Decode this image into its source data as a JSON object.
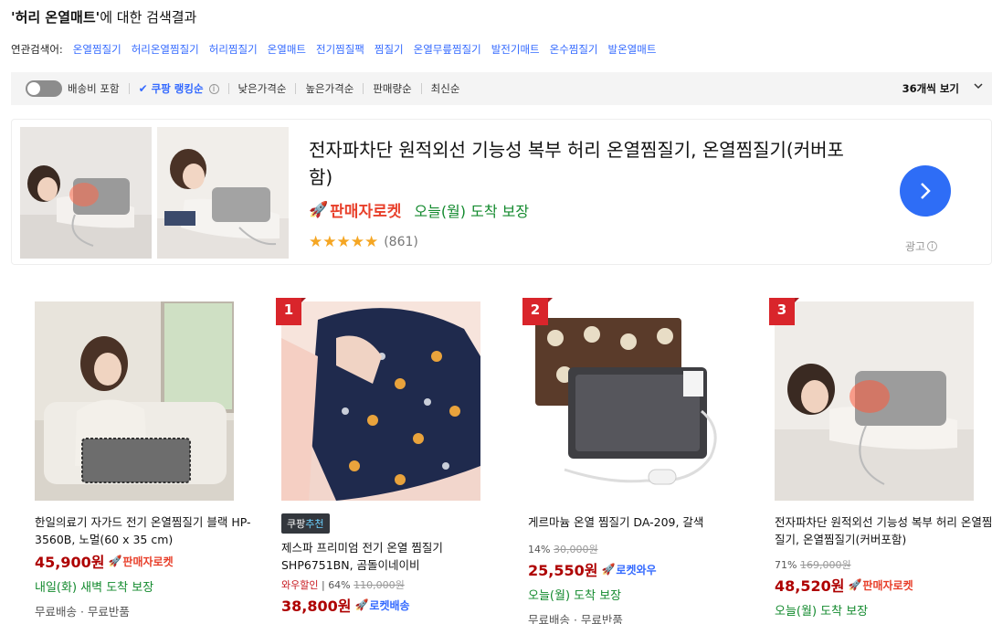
{
  "search": {
    "keyword": "'허리 온열매트'",
    "suffix": "에 대한 검색결과"
  },
  "related": {
    "label": "연관검색어:",
    "terms": [
      "온열찜질기",
      "허리온열찜질기",
      "허리찜질기",
      "온열매트",
      "전기찜질팩",
      "찜질기",
      "온열무릎찜질기",
      "발전기매트",
      "온수찜질기",
      "발온열매트"
    ]
  },
  "sortbar": {
    "shipping_label": "배송비 포함",
    "options": [
      "쿠팡 랭킹순",
      "낮은가격순",
      "높은가격순",
      "판매량순",
      "최신순"
    ],
    "active_index": 0,
    "per_page": "36개씩 보기"
  },
  "ad": {
    "title": "전자파차단 원적외선 기능성 복부 허리 온열찜질기, 온열찜질기(커버포함)",
    "rocket_label": "판매자로켓",
    "arrival": "오늘(월) 도착 보장",
    "rating": 5,
    "review_count": "(861)",
    "ad_label": "광고"
  },
  "products": [
    {
      "rank": "",
      "recommended": "",
      "name": "한일의료기 자가드 전기 온열찜질기 블랙 HP-3560B, 노멀(60 x 35 cm)",
      "discount_label": "",
      "discount_pct": "",
      "original_price": "",
      "price": "45,900원",
      "delivery_badge": "판매자로켓",
      "delivery_color": "red",
      "arrival": "내일(화) 새벽 도착 보장",
      "shipping": "무료배송 · 무료반품"
    },
    {
      "rank": "1",
      "recommended": "쿠팡추천",
      "name": "제스파 프리미엄 전기 온열 찜질기 SHP6751BN, 곰돌이네이비",
      "discount_label": "와우할인",
      "discount_pct": "64%",
      "original_price": "110,000원",
      "price": "38,800원",
      "delivery_badge": "로켓배송",
      "delivery_color": "blue",
      "arrival": "",
      "shipping": ""
    },
    {
      "rank": "2",
      "recommended": "",
      "name": "게르마늄 온열 찜질기 DA-209, 갈색",
      "discount_label": "",
      "discount_pct": "14%",
      "original_price": "30,000원",
      "price": "25,550원",
      "delivery_badge": "로켓와우",
      "delivery_color": "blue",
      "arrival": "오늘(월) 도착 보장",
      "shipping": "무료배송 · 무료반품"
    },
    {
      "rank": "3",
      "recommended": "",
      "name": "전자파차단 원적외선 기능성 복부 허리 온열찜질기, 온열찜질기(커버포함)",
      "discount_label": "",
      "discount_pct": "71%",
      "original_price": "169,000원",
      "price": "48,520원",
      "delivery_badge": "판매자로켓",
      "delivery_color": "red",
      "arrival": "오늘(월) 도착 보장",
      "shipping": ""
    }
  ],
  "colors": {
    "link_blue": "#346aff",
    "price_red": "#ae0000",
    "rocket_red": "#e8402b",
    "arrival_green": "#138a2e",
    "rank_red": "#d9252b",
    "next_blue": "#2e6df6"
  }
}
